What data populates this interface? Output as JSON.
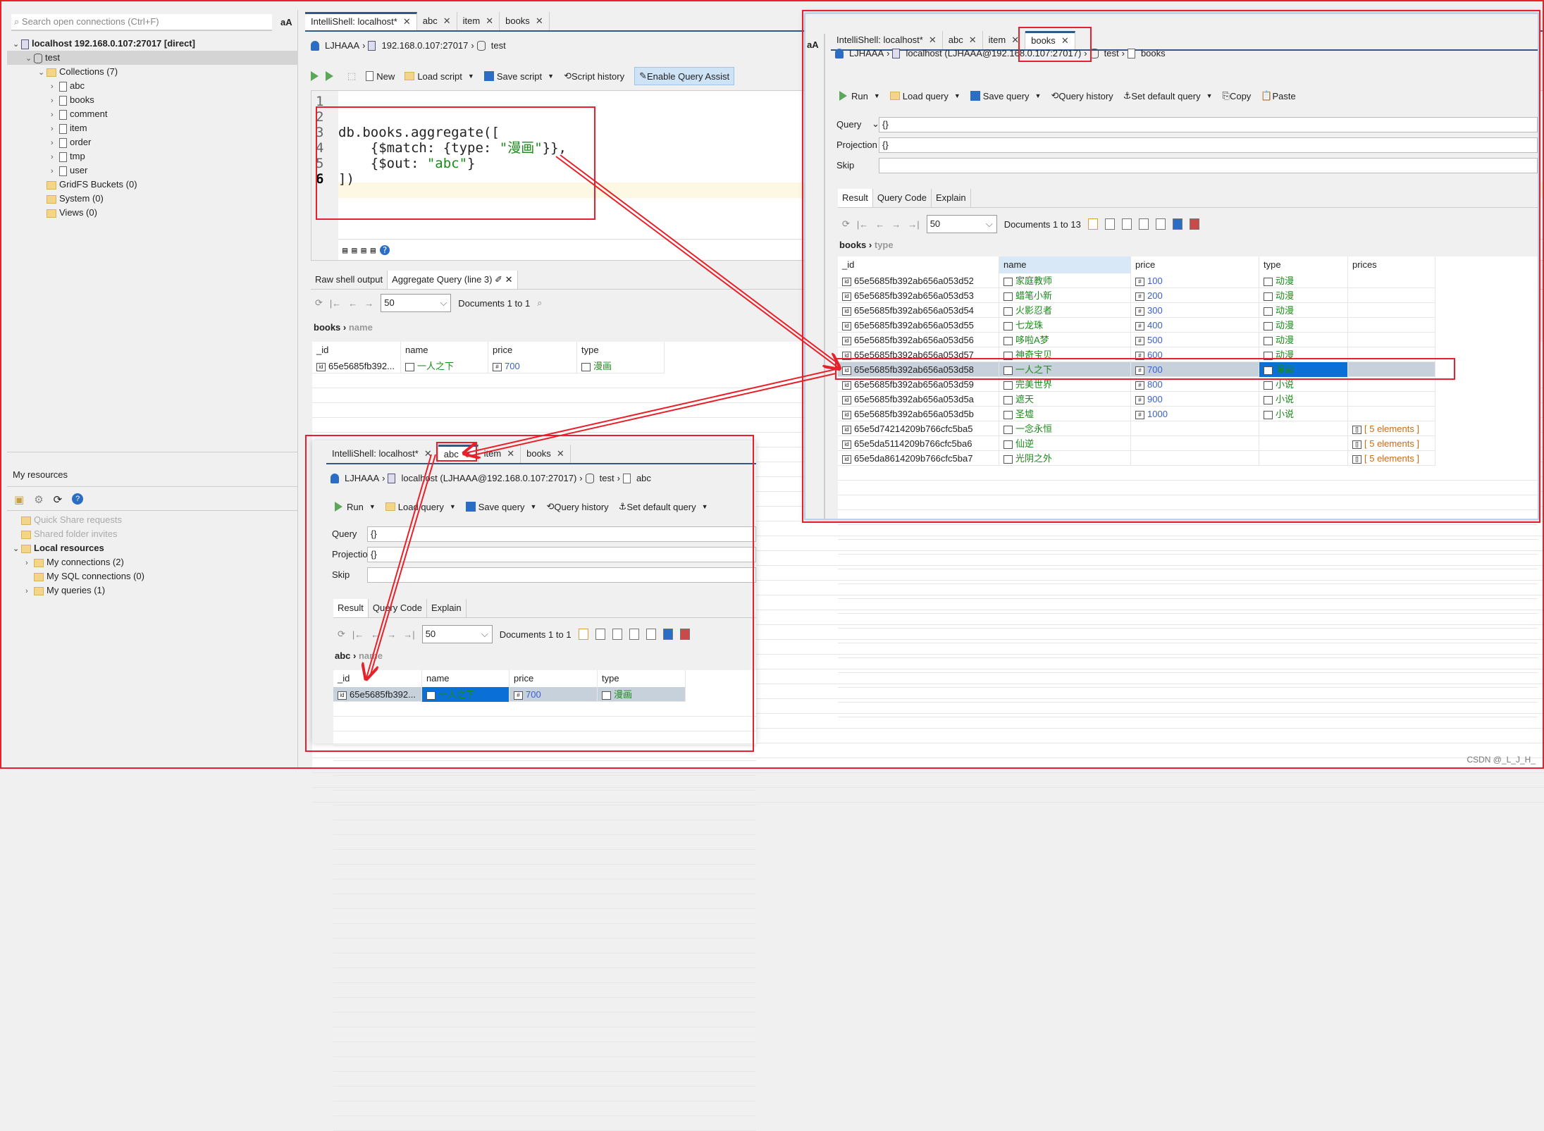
{
  "left": {
    "search_placeholder": "Search open connections (Ctrl+F)",
    "font_toggle": "aA",
    "tree": [
      {
        "label": "localhost 192.168.0.107:27017 [direct]",
        "level": 0,
        "icon": "server-icon",
        "bold": true,
        "chev": "v"
      },
      {
        "label": "test",
        "level": 1,
        "icon": "database-icon",
        "chev": "v",
        "selected": true
      },
      {
        "label": "Collections (7)",
        "level": 2,
        "icon": "folder-icon",
        "chev": "v"
      },
      {
        "label": "abc",
        "level": 3,
        "icon": "collection-icon",
        "chev": ">"
      },
      {
        "label": "books",
        "level": 3,
        "icon": "collection-icon",
        "chev": ">"
      },
      {
        "label": "comment",
        "level": 3,
        "icon": "collection-icon",
        "chev": ">"
      },
      {
        "label": "item",
        "level": 3,
        "icon": "collection-icon",
        "chev": ">"
      },
      {
        "label": "order",
        "level": 3,
        "icon": "collection-icon",
        "chev": ">"
      },
      {
        "label": "tmp",
        "level": 3,
        "icon": "collection-icon",
        "chev": ">"
      },
      {
        "label": "user",
        "level": 3,
        "icon": "collection-icon",
        "chev": ">"
      },
      {
        "label": "GridFS Buckets (0)",
        "level": 2,
        "icon": "folder-icon",
        "chev": ""
      },
      {
        "label": "System (0)",
        "level": 2,
        "icon": "folder-icon",
        "chev": ""
      },
      {
        "label": "Views (0)",
        "level": 2,
        "icon": "folder-icon",
        "chev": ""
      }
    ],
    "resources_title": "My resources",
    "resources": [
      {
        "label": "Quick Share requests",
        "disabled": true,
        "level": 0,
        "chev": ""
      },
      {
        "label": "Shared folder invites",
        "disabled": true,
        "level": 0,
        "chev": ""
      },
      {
        "label": "Local resources",
        "bold": true,
        "level": 0,
        "chev": "v"
      },
      {
        "label": "My connections (2)",
        "level": 1,
        "chev": ">"
      },
      {
        "label": "My SQL connections (0)",
        "level": 1,
        "chev": ""
      },
      {
        "label": "My queries (1)",
        "level": 1,
        "chev": ">"
      }
    ]
  },
  "main": {
    "tabs": [
      {
        "label": "IntelliShell: localhost*",
        "active": true
      },
      {
        "label": "abc"
      },
      {
        "label": "item"
      },
      {
        "label": "books"
      }
    ],
    "crumb": {
      "user": "LJHAAA",
      "host": "192.168.0.107:27017",
      "db": "test"
    },
    "toolbar": [
      "New",
      "Load script",
      "Save script",
      "Script history",
      "Enable Query Assist"
    ],
    "code": [
      {
        "n": "1",
        "t": ""
      },
      {
        "n": "2",
        "t": ""
      },
      {
        "n": "3",
        "t": "db.books.aggregate(["
      },
      {
        "n": "4",
        "t": "    {$match: {type: ",
        "s": "\"漫画\"",
        "e": "}},"
      },
      {
        "n": "5",
        "t": "    {$out: ",
        "s": "\"abc\"",
        "e": "}"
      },
      {
        "n": "6",
        "t": "])"
      }
    ],
    "result_tabs": [
      "Raw shell output",
      "Aggregate Query (line 3)"
    ],
    "page_size": "50",
    "doc_count": "Documents 1 to 1",
    "path": {
      "coll": "books",
      "field": "name"
    },
    "columns": [
      "_id",
      "name",
      "price",
      "type"
    ],
    "rows": [
      {
        "_id": "65e5685fb392...",
        "name": "一人之下",
        "price": "700",
        "type": "漫画"
      }
    ]
  },
  "books_window": {
    "font_toggle": "aA",
    "tabs": [
      {
        "label": "IntelliShell: localhost*"
      },
      {
        "label": "abc"
      },
      {
        "label": "item"
      },
      {
        "label": "books",
        "active": true
      }
    ],
    "crumb": {
      "user": "LJHAAA",
      "host": "localhost (LJHAAA@192.168.0.107:27017)",
      "db": "test",
      "coll": "books"
    },
    "toolbar": [
      "Run",
      "Load query",
      "Save query",
      "Query history",
      "Set default query",
      "Copy",
      "Paste"
    ],
    "query_label": "Query",
    "query": "{}",
    "projection_label": "Projection",
    "projection": "{}",
    "skip_label": "Skip",
    "skip": "",
    "result_tabs": [
      "Result",
      "Query Code",
      "Explain"
    ],
    "page_size": "50",
    "doc_count": "Documents 1 to 13",
    "path": {
      "coll": "books",
      "field": "type"
    },
    "columns": [
      "_id",
      "name",
      "price",
      "type",
      "prices"
    ],
    "rows": [
      {
        "_id": "65e5685fb392ab656a053d52",
        "name": "家庭教师",
        "price": "100",
        "type": "动漫",
        "prices": ""
      },
      {
        "_id": "65e5685fb392ab656a053d53",
        "name": "蜡笔小新",
        "price": "200",
        "type": "动漫",
        "prices": ""
      },
      {
        "_id": "65e5685fb392ab656a053d54",
        "name": "火影忍者",
        "price": "300",
        "type": "动漫",
        "prices": ""
      },
      {
        "_id": "65e5685fb392ab656a053d55",
        "name": "七龙珠",
        "price": "400",
        "type": "动漫",
        "prices": ""
      },
      {
        "_id": "65e5685fb392ab656a053d56",
        "name": "哆啦A梦",
        "price": "500",
        "type": "动漫",
        "prices": ""
      },
      {
        "_id": "65e5685fb392ab656a053d57",
        "name": "神奇宝贝",
        "price": "600",
        "type": "动漫",
        "prices": ""
      },
      {
        "_id": "65e5685fb392ab656a053d58",
        "name": "一人之下",
        "price": "700",
        "type": "漫画",
        "prices": "",
        "selected": true
      },
      {
        "_id": "65e5685fb392ab656a053d59",
        "name": "完美世界",
        "price": "800",
        "type": "小说",
        "prices": ""
      },
      {
        "_id": "65e5685fb392ab656a053d5a",
        "name": "遮天",
        "price": "900",
        "type": "小说",
        "prices": ""
      },
      {
        "_id": "65e5685fb392ab656a053d5b",
        "name": "圣墟",
        "price": "1000",
        "type": "小说",
        "prices": ""
      },
      {
        "_id": "65e5d74214209b766cfc5ba5",
        "name": "一念永恒",
        "price": "",
        "type": "",
        "prices": "[ 5 elements ]"
      },
      {
        "_id": "65e5da5114209b766cfc5ba6",
        "name": "仙逆",
        "price": "",
        "type": "",
        "prices": "[ 5 elements ]"
      },
      {
        "_id": "65e5da8614209b766cfc5ba7",
        "name": "光阴之外",
        "price": "",
        "type": "",
        "prices": "[ 5 elements ]"
      }
    ]
  },
  "abc_window": {
    "tabs": [
      {
        "label": "IntelliShell: localhost*"
      },
      {
        "label": "abc",
        "active": true
      },
      {
        "label": "item"
      },
      {
        "label": "books"
      }
    ],
    "crumb": {
      "user": "LJHAAA",
      "host": "localhost (LJHAAA@192.168.0.107:27017)",
      "db": "test",
      "coll": "abc"
    },
    "toolbar": [
      "Run",
      "Load query",
      "Save query",
      "Query history",
      "Set default query"
    ],
    "query_label": "Query",
    "query": "{}",
    "projection_label": "Projection",
    "projection": "{}",
    "skip_label": "Skip",
    "skip": "",
    "result_tabs": [
      "Result",
      "Query Code",
      "Explain"
    ],
    "page_size": "50",
    "doc_count": "Documents 1 to 1",
    "path": {
      "coll": "abc",
      "field": "name"
    },
    "columns": [
      "_id",
      "name",
      "price",
      "type"
    ],
    "rows": [
      {
        "_id": "65e5685fb392...",
        "name": "一人之下",
        "price": "700",
        "type": "漫画",
        "selected": true
      }
    ]
  },
  "watermark": "CSDN @_L_J_H_",
  "colors": {
    "annotation": "#e8202a",
    "accent": "#2d5a8a",
    "selection": "#0a6fd6",
    "string": "#1a8a1a",
    "number": "#3a5fd6"
  }
}
